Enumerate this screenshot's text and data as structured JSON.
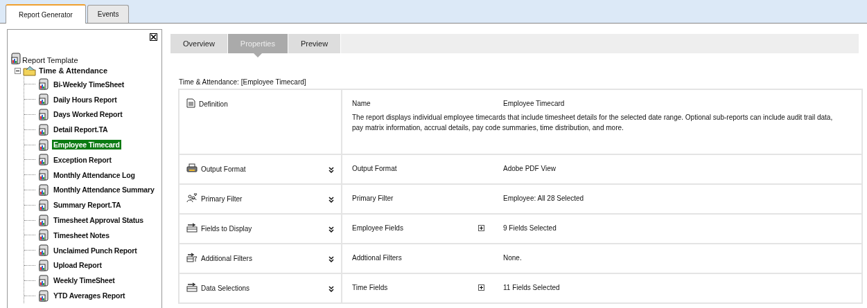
{
  "top_tabs": [
    {
      "label": "Report Generator",
      "selected": true
    },
    {
      "label": "Events",
      "selected": false
    }
  ],
  "tree": {
    "label": "Report Template",
    "children": [
      {
        "label": "Time & Attendance",
        "expanded": true,
        "children": [
          {
            "label": "Bi-Weekly TimeSheet",
            "selected": false
          },
          {
            "label": "Daily Hours Report",
            "selected": false
          },
          {
            "label": "Days Worked Report",
            "selected": false
          },
          {
            "label": "Detail Report.TA",
            "selected": false
          },
          {
            "label": "Employee Timecard",
            "selected": true
          },
          {
            "label": "Exception Report",
            "selected": false
          },
          {
            "label": "Monthly Attendance Log",
            "selected": false
          },
          {
            "label": "Monthly Attendance Summary",
            "selected": false
          },
          {
            "label": "Summary Report.TA",
            "selected": false
          },
          {
            "label": "Timesheet Approval Status",
            "selected": false
          },
          {
            "label": "Timesheet Notes",
            "selected": false
          },
          {
            "label": "Unclaimed Punch Report",
            "selected": false
          },
          {
            "label": "Upload Report",
            "selected": false
          },
          {
            "label": "Weekly TimeSheet",
            "selected": false
          },
          {
            "label": "YTD Averages Report",
            "selected": false
          }
        ]
      }
    ]
  },
  "view_tabs": [
    {
      "label": "Overview",
      "selected": false
    },
    {
      "label": "Properties",
      "selected": true
    },
    {
      "label": "Preview",
      "selected": false
    }
  ],
  "heading": "Time & Attendance: [Employee Timecard]",
  "sections": [
    {
      "kind": "definition",
      "title": "Definition",
      "field": "Name",
      "value": "Employee Timecard",
      "description": "The report displays individual employee timecards that include timesheet details for the selected date range. Optional sub-reports can include audit trail data, pay matrix information, accrual details, pay code summaries, time distribution, and more."
    },
    {
      "kind": "setting",
      "title": "Output Format",
      "field": "Output Format",
      "expandable": false,
      "value": "Adobe PDF View"
    },
    {
      "kind": "setting",
      "title": "Primary Filter",
      "field": "Primary Filter",
      "expandable": false,
      "value": "Employee: All 28 Selected"
    },
    {
      "kind": "setting",
      "title": "Fields to Display",
      "field": "Employee Fields",
      "expandable": true,
      "value": "9 Fields Selected"
    },
    {
      "kind": "setting",
      "title": "Additional Filters",
      "field": "Addtional Filters",
      "expandable": false,
      "value": "None."
    },
    {
      "kind": "setting",
      "title": "Data Selections",
      "field": "Time Fields",
      "expandable": true,
      "value": "11 Fields Selected"
    }
  ]
}
